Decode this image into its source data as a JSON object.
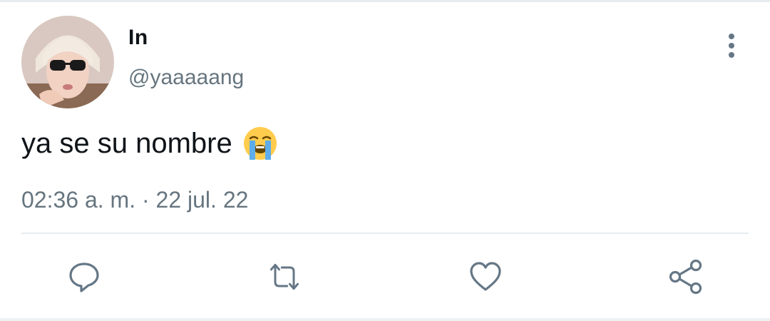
{
  "tweet": {
    "display_name": "In",
    "handle": "@yaaaaang",
    "text": "ya se su nombre",
    "emoji": "loudly-crying-face",
    "timestamp": "02:36 a. m. · 22 jul. 22"
  },
  "icons": {
    "more": "more-vertical-icon",
    "reply": "reply-icon",
    "retweet": "retweet-icon",
    "like": "heart-icon",
    "share": "share-icon"
  },
  "colors": {
    "text_primary": "#0f1419",
    "text_secondary": "#66757f",
    "icon": "#657786",
    "divider": "#e6ecf0"
  }
}
